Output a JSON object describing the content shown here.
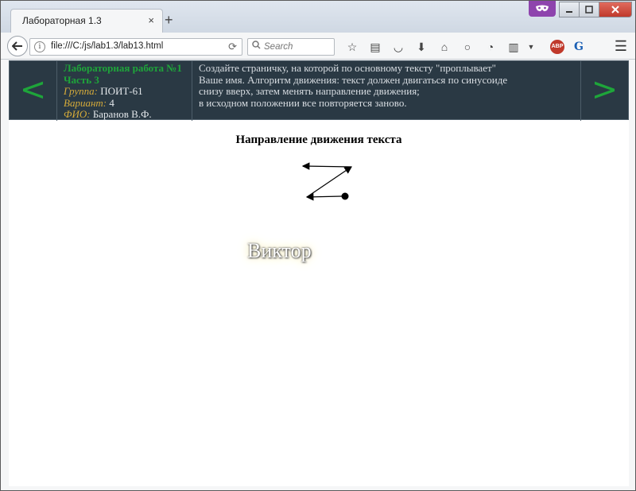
{
  "browser": {
    "tab_title": "Лабораторная 1.3",
    "tab_close": "×",
    "new_tab": "+",
    "url": "file:///C:/js/lab1.3/lab13.html",
    "search_placeholder": "Search",
    "info": "i",
    "abp_label": "ABP",
    "g_label": "G"
  },
  "header": {
    "prev": "<",
    "next": ">",
    "lab_title": "Лабораторная работа №1",
    "lab_part": "Часть 3",
    "group_label": "Группа:",
    "group_value": "ПОИТ-61",
    "variant_label": "Вариант:",
    "variant_value": "4",
    "fio_label": "ФИО:",
    "fio_value": "Баранов В.Ф.",
    "task_lines": [
      "Создайте страничку, на которой по основному тексту \"проплывает\"",
      "Ваше имя. Алгоритм движения: текст должен двигаться по синусоиде",
      "снизу вверх, затем менять направление движения;",
      "в исходном положении все повторяется заново."
    ]
  },
  "content": {
    "direction_heading": "Направление движения текста",
    "floating_name": "Виктор"
  },
  "colors": {
    "header_bg": "#2a3944",
    "accent_green": "#1ea53a",
    "label_gold": "#d4aa3a"
  }
}
